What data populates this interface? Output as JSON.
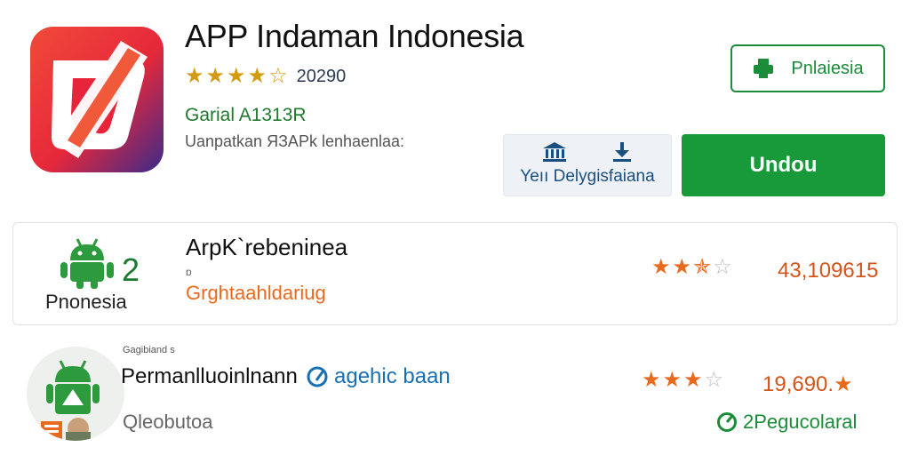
{
  "app": {
    "title": "APP Indaman Indonesia",
    "rating_text": "20290",
    "rating": 4.5,
    "developer": "Garial A1313R",
    "subtitle": "Uanpatkan ЯЗАPk lenhaenlaa:"
  },
  "actions": {
    "badge_label": "Pnlaiesia",
    "secondary_label": "Yeıı Delygisfaiana",
    "primary_label": "Undou"
  },
  "list": {
    "item1": {
      "icon_number": "2",
      "icon_caption": "Pnonesia",
      "title": "ArpK`rebeninea",
      "mini": "ɒ",
      "subtitle": "Grghtaahldariug",
      "rating": 2.5,
      "count": "43,109615"
    },
    "item2": {
      "tiny": "Gagibiand s",
      "title": "Permanlluoinlnann",
      "link": "agehic baan",
      "subtitle": "Qleobutoa",
      "rating": 3,
      "count": "19,690.",
      "status": "2Pegucolaral"
    }
  },
  "colors": {
    "primary_green": "#199a3a",
    "accent_orange": "#e86a1e",
    "star_gold": "#d39a12"
  }
}
